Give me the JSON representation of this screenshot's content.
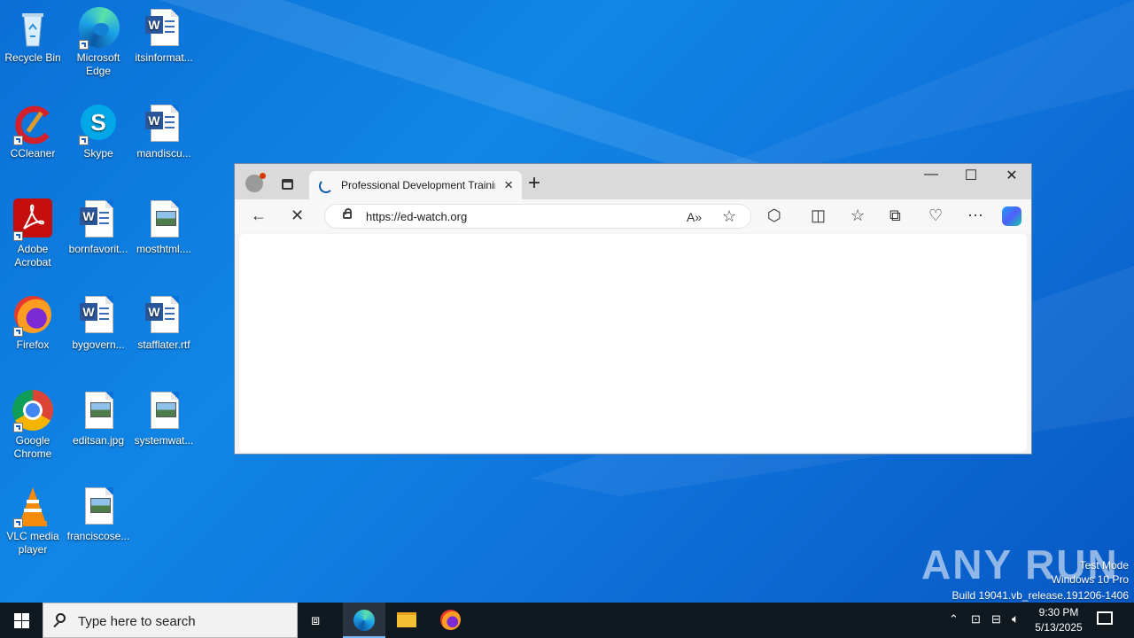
{
  "desktop": {
    "icons": [
      {
        "label": "Recycle Bin",
        "icon": "recycle-bin-icon"
      },
      {
        "label": "Microsoft Edge",
        "icon": "edge-icon"
      },
      {
        "label": "itsinformat...",
        "icon": "word-doc-icon"
      },
      {
        "label": "CCleaner",
        "icon": "ccleaner-icon"
      },
      {
        "label": "Skype",
        "icon": "skype-icon"
      },
      {
        "label": "mandiscu...",
        "icon": "word-doc-icon"
      },
      {
        "label": "Adobe Acrobat",
        "icon": "acrobat-icon"
      },
      {
        "label": "bornfavorit...",
        "icon": "word-doc-icon"
      },
      {
        "label": "mosthtml....",
        "icon": "image-file-icon"
      },
      {
        "label": "Firefox",
        "icon": "firefox-icon"
      },
      {
        "label": "bygovern...",
        "icon": "word-doc-icon"
      },
      {
        "label": "stafflater.rtf",
        "icon": "word-doc-icon"
      },
      {
        "label": "Google Chrome",
        "icon": "chrome-icon"
      },
      {
        "label": "editsan.jpg",
        "icon": "image-file-icon"
      },
      {
        "label": "systemwat...",
        "icon": "image-file-icon"
      },
      {
        "label": "VLC media player",
        "icon": "vlc-icon"
      },
      {
        "label": "franciscose...",
        "icon": "image-file-icon"
      }
    ]
  },
  "browser": {
    "tab_title": "Professional Development Training",
    "url": "https://ed-watch.org",
    "window_controls": {
      "minimize": "—",
      "maximize": "☐",
      "close": "✕"
    }
  },
  "watermark": {
    "brand": "ANY RUN",
    "line1": "Test Mode",
    "line2": "Windows 10 Pro",
    "line3": "Build 19041.vb_release.191206-1406"
  },
  "taskbar": {
    "search_placeholder": "Type here to search",
    "time": "9:30 PM",
    "date": "5/13/2025"
  },
  "colors": {
    "accent": "#0078d4",
    "taskbar": "#101820"
  }
}
